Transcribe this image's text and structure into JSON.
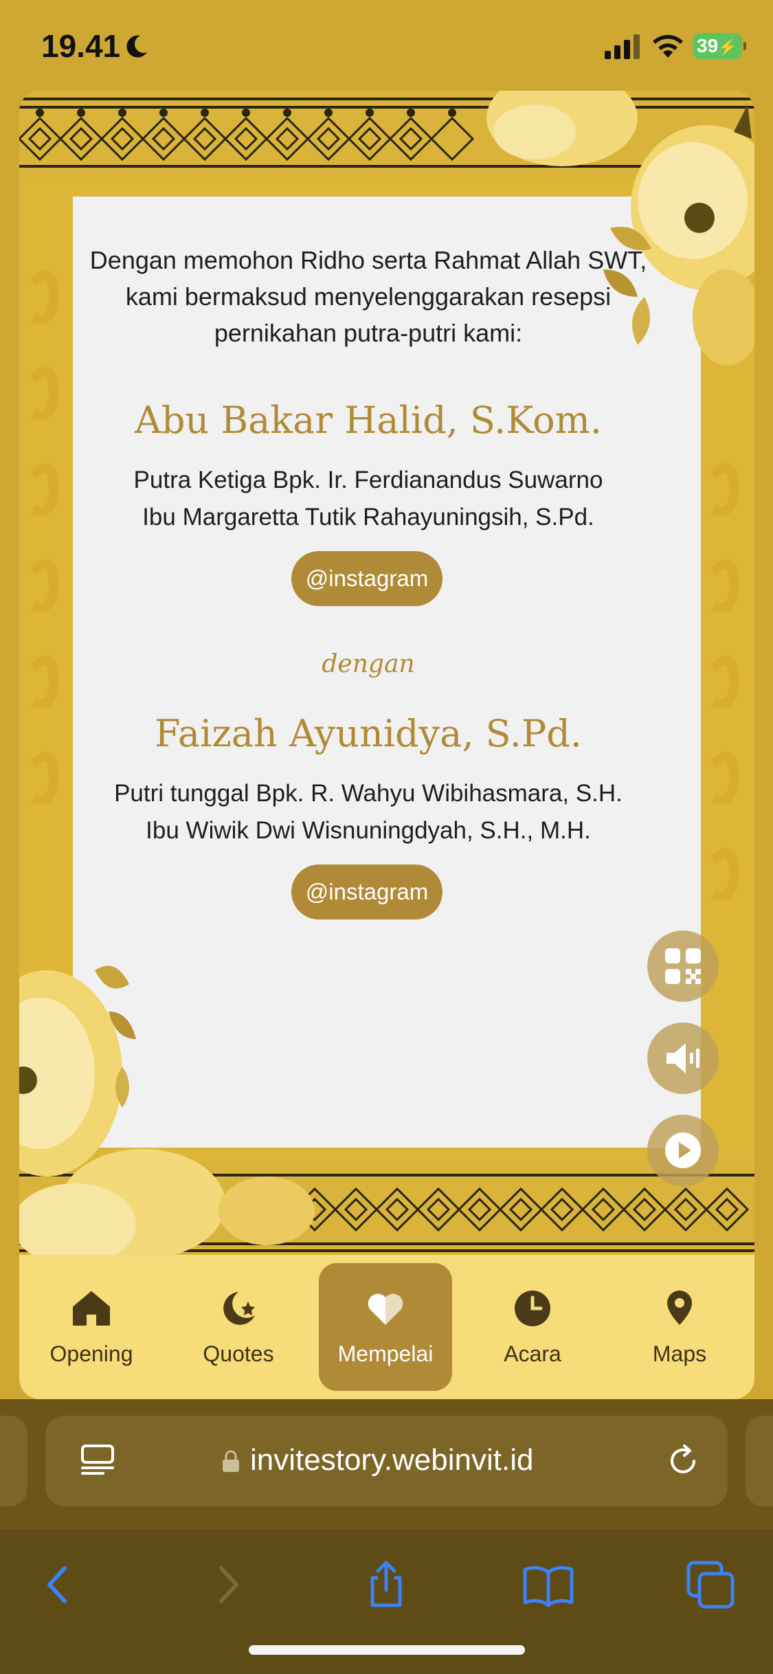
{
  "status_bar": {
    "time": "19.41",
    "battery": "39"
  },
  "invitation": {
    "intro": "Dengan memohon Ridho serta Rahmat Allah SWT,\nkami bermaksud menyelenggarakan resepsi\npernikahan putra-putri kami:",
    "groom": {
      "name": "Abu Bakar Halid, S.Kom.",
      "parents": "Putra Ketiga Bpk. Ir. Ferdianandus Suwarno\nIbu Margaretta Tutik Rahayuningsih, S.Pd.",
      "instagram_label": "@instagram"
    },
    "connector": "dengan",
    "bride": {
      "name": "Faizah Ayunidya, S.Pd.",
      "parents": "Putri tunggal Bpk. R. Wahyu Wibihasmara, S.H.\nIbu Wiwik Dwi Wisnuningdyah, S.H., M.H.",
      "instagram_label": "@instagram"
    }
  },
  "floating_buttons": {
    "icons": [
      "qr-code-icon",
      "speaker-icon",
      "play-icon"
    ]
  },
  "nav": {
    "items": [
      {
        "label": "Opening",
        "icon": "home-icon",
        "active": false
      },
      {
        "label": "Quotes",
        "icon": "moon-star-icon",
        "active": false
      },
      {
        "label": "Mempelai",
        "icon": "heart-icon",
        "active": true
      },
      {
        "label": "Acara",
        "icon": "clock-icon",
        "active": false
      },
      {
        "label": "Maps",
        "icon": "map-pin-icon",
        "active": false
      }
    ]
  },
  "browser": {
    "url": "invitestory.webinvit.id"
  },
  "colors": {
    "background": "#cfa833",
    "accent_gold": "#b08a36",
    "nav_bg": "#f7dc7a",
    "browser_chrome": "#6a5518",
    "toolbar_icons": "#3b82f6"
  }
}
